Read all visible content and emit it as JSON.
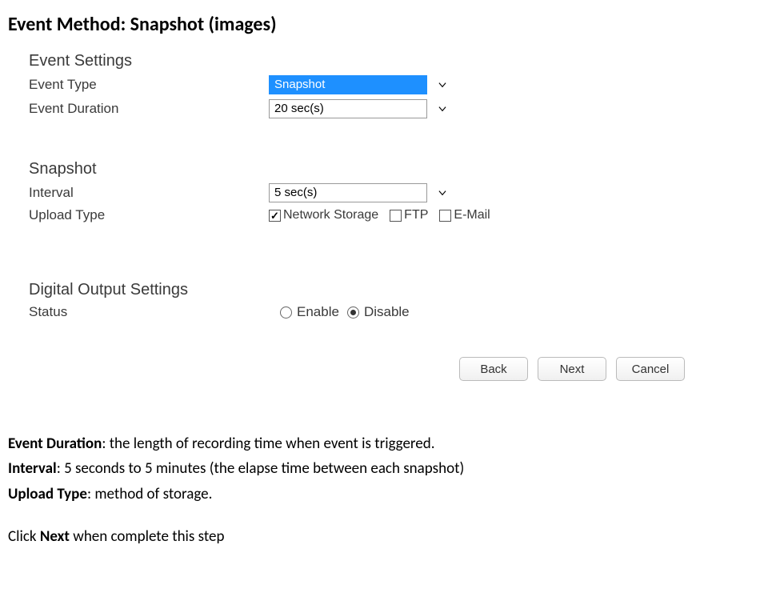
{
  "title": "Event Method: Snapshot (images)",
  "form": {
    "event_settings": {
      "heading": "Event Settings",
      "event_type": {
        "label": "Event Type",
        "value": "Snapshot"
      },
      "event_duration": {
        "label": "Event Duration",
        "value": "20 sec(s)"
      }
    },
    "snapshot": {
      "heading": "Snapshot",
      "interval": {
        "label": "Interval",
        "value": "5 sec(s)"
      },
      "upload_type": {
        "label": "Upload Type",
        "options": {
          "network_storage": {
            "label": "Network Storage",
            "checked": true
          },
          "ftp": {
            "label": "FTP",
            "checked": false
          },
          "email": {
            "label": "E-Mail",
            "checked": false
          }
        }
      }
    },
    "digital_output": {
      "heading": "Digital Output Settings",
      "status": {
        "label": "Status",
        "enable": "Enable",
        "disable": "Disable",
        "value": "Disable"
      }
    },
    "buttons": {
      "back": "Back",
      "next": "Next",
      "cancel": "Cancel"
    }
  },
  "description": {
    "d1_label": "Event Duration",
    "d1_text": ": the length of recording time when event is triggered.",
    "d2_label": "Interval",
    "d2_text": ": 5 seconds to 5 minutes (the elapse time between each snapshot)",
    "d3_label": "Upload Type",
    "d3_text": ": method of storage.",
    "closing_a": "Click ",
    "closing_b": "Next",
    "closing_c": " when complete this step"
  }
}
